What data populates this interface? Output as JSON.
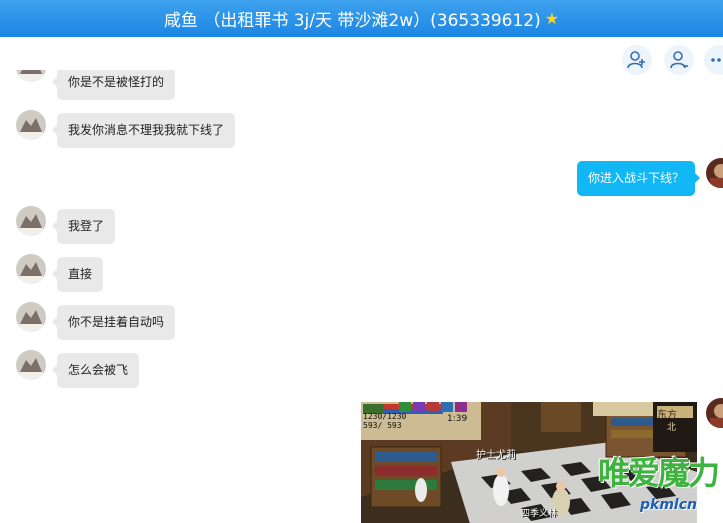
{
  "window": {
    "title": "咸鱼 （出租罪书 3j/天 带沙滩2w）(365339612)",
    "title_icon": "star-icon"
  },
  "toolbar": {
    "buttons": [
      {
        "name": "add-member-button",
        "icon": "user-plus-icon"
      },
      {
        "name": "members-button",
        "icon": "users-icon"
      },
      {
        "name": "more-button",
        "icon": "more-icon"
      }
    ]
  },
  "messages": [
    {
      "dir": "in",
      "text": "你是不是被怪打的"
    },
    {
      "dir": "in",
      "text": "我发你消息不理我我就下线了"
    },
    {
      "dir": "out",
      "text": "你进入战斗下线？"
    },
    {
      "dir": "in",
      "text": "我登了"
    },
    {
      "dir": "in",
      "text": "直接"
    },
    {
      "dir": "in",
      "text": "你不是挂着自动吗"
    },
    {
      "dir": "in",
      "text": "怎么会被飞"
    },
    {
      "dir": "out",
      "type": "image"
    }
  ],
  "game_screenshot": {
    "hp": "1230/1230",
    "mp": "593/ 593",
    "time": "1:39",
    "region": "东方",
    "direction": "北",
    "npc_name": "护士尤莉",
    "player_name": "四季义林",
    "watermark": "唯爱魔力",
    "watermark_url": "pkmlcn"
  },
  "colors": {
    "titlebar": "#1b86e3",
    "bubble_in": "#e9e9ea",
    "bubble_out": "#12b7f5"
  }
}
